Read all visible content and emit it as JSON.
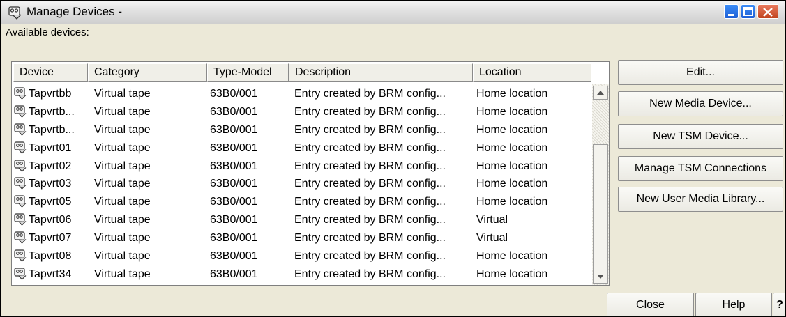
{
  "window": {
    "title": "Manage Devices -",
    "minimize_icon": "minimize-icon",
    "maximize_icon": "maximize-icon",
    "close_icon": "close-icon",
    "app_icon": "tape-device-icon"
  },
  "available_label": "Available devices:",
  "table": {
    "columns": [
      "Device",
      "Category",
      "Type-Model",
      "Description",
      "Location"
    ],
    "row_icon": "tape-device-icon",
    "rows": [
      {
        "device": "Tapvrtbb",
        "category": "Virtual tape",
        "type_model": "63B0/001",
        "description": "Entry created by BRM config...",
        "location": "Home location"
      },
      {
        "device": "Tapvrtb...",
        "category": "Virtual tape",
        "type_model": "63B0/001",
        "description": "Entry created by BRM config...",
        "location": "Home location"
      },
      {
        "device": "Tapvrtb...",
        "category": "Virtual tape",
        "type_model": "63B0/001",
        "description": "Entry created by BRM config...",
        "location": "Home location"
      },
      {
        "device": "Tapvrt01",
        "category": "Virtual tape",
        "type_model": "63B0/001",
        "description": "Entry created by BRM config...",
        "location": "Home location"
      },
      {
        "device": "Tapvrt02",
        "category": "Virtual tape",
        "type_model": "63B0/001",
        "description": "Entry created by BRM config...",
        "location": "Home location"
      },
      {
        "device": "Tapvrt03",
        "category": "Virtual tape",
        "type_model": "63B0/001",
        "description": "Entry created by BRM config...",
        "location": "Home location"
      },
      {
        "device": "Tapvrt05",
        "category": "Virtual tape",
        "type_model": "63B0/001",
        "description": "Entry created by BRM config...",
        "location": "Home location"
      },
      {
        "device": "Tapvrt06",
        "category": "Virtual tape",
        "type_model": "63B0/001",
        "description": "Entry created by BRM config...",
        "location": "Virtual"
      },
      {
        "device": "Tapvrt07",
        "category": "Virtual tape",
        "type_model": "63B0/001",
        "description": "Entry created by BRM config...",
        "location": "Virtual"
      },
      {
        "device": "Tapvrt08",
        "category": "Virtual tape",
        "type_model": "63B0/001",
        "description": "Entry created by BRM config...",
        "location": "Home location"
      },
      {
        "device": "Tapvrt34",
        "category": "Virtual tape",
        "type_model": "63B0/001",
        "description": "Entry created by BRM config...",
        "location": "Home location"
      }
    ]
  },
  "side_buttons": [
    "Edit...",
    "New Media Device...",
    "New TSM Device...",
    "Manage TSM Connections",
    "New User Media Library..."
  ],
  "bottom_buttons": {
    "close": "Close",
    "help": "Help",
    "whats_this": "?"
  },
  "colors": {
    "window_bg": "#ece9d8",
    "titlebar_blue": "#1e5fd6",
    "close_red": "#c1441f"
  }
}
